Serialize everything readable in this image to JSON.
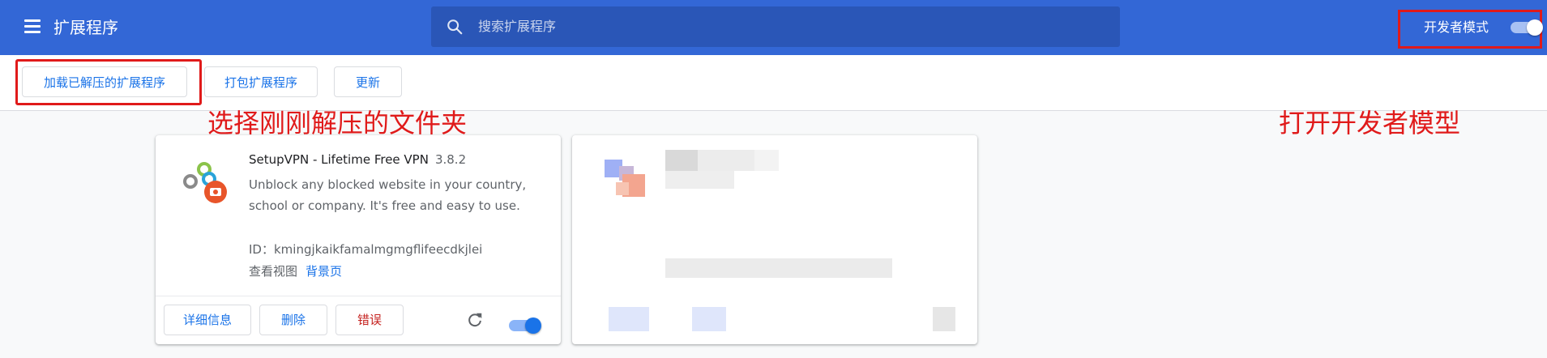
{
  "header": {
    "title": "扩展程序",
    "search_placeholder": "搜索扩展程序",
    "dev_mode_label": "开发者模式",
    "dev_mode_on": true
  },
  "toolbar": {
    "load_unpacked": "加载已解压的扩展程序",
    "pack": "打包扩展程序",
    "update": "更新"
  },
  "annotations": {
    "select_folder": "选择刚刚解压的文件夹",
    "enable_dev": "打开开发者模型"
  },
  "extension": {
    "name": "SetupVPN - Lifetime Free VPN",
    "version": "3.8.2",
    "description": "Unblock any blocked website in your country, school or company. It's free and easy to use.",
    "id_label": "ID：kmingjkaikfamalmgmgflifeecdkjlei",
    "inspect_label": "查看视图",
    "inspect_link": "背景页",
    "details_button": "详细信息",
    "remove_button": "删除",
    "errors_button": "错误",
    "enabled": true
  },
  "icons": [
    "menu-icon",
    "search-icon",
    "extension-logo-icon",
    "reload-icon"
  ],
  "colors": {
    "brand": "#3367d6",
    "accent": "#1a73e8",
    "annotation": "#e01a1a"
  }
}
